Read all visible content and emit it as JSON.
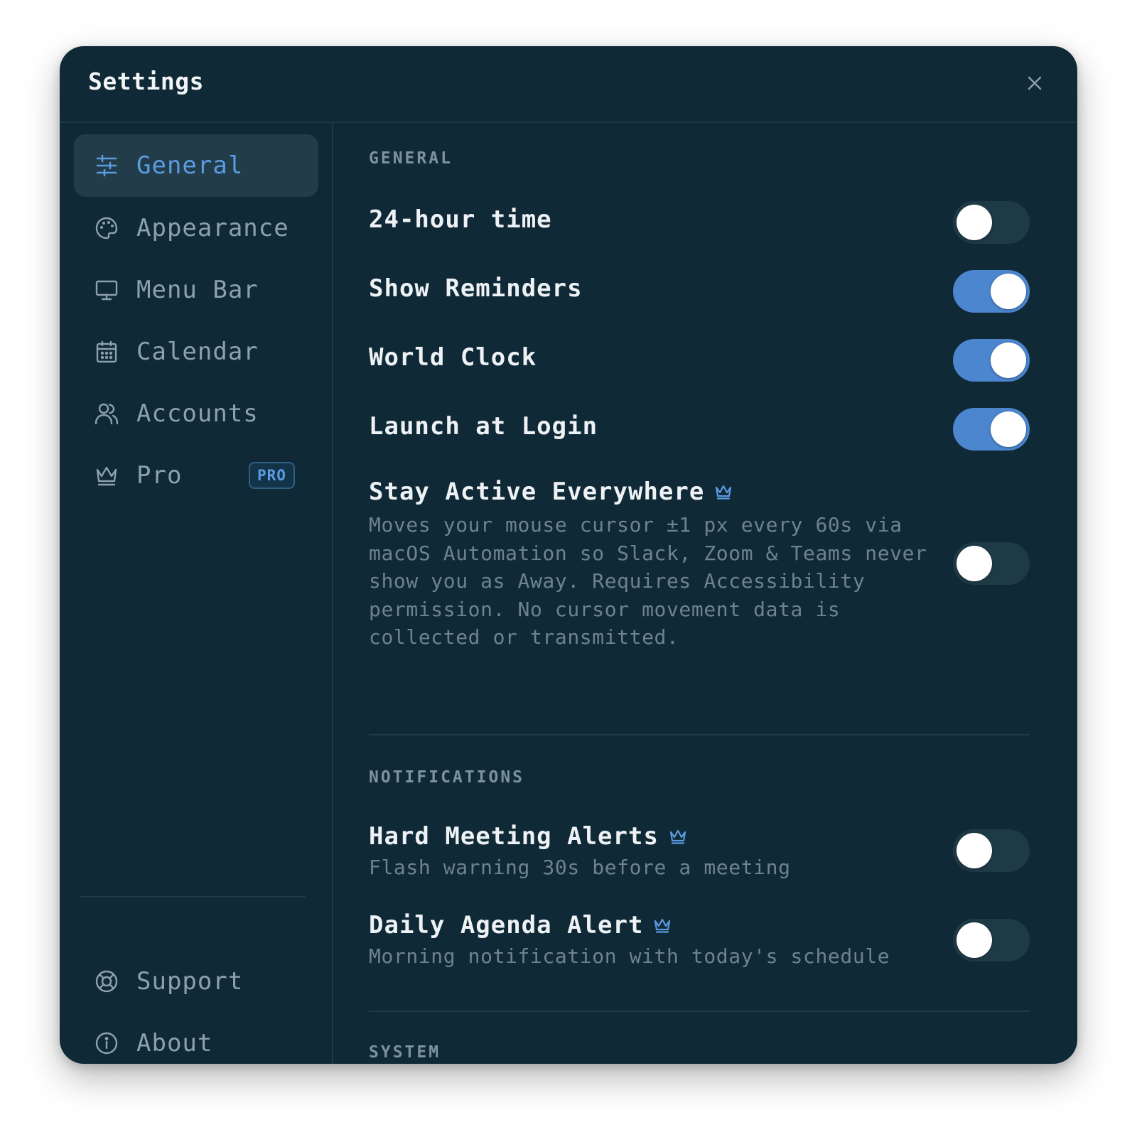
{
  "window": {
    "title": "Settings"
  },
  "sidebar": {
    "items": [
      {
        "label": "General",
        "icon": "sliders-icon",
        "active": true
      },
      {
        "label": "Appearance",
        "icon": "palette-icon",
        "active": false
      },
      {
        "label": "Menu Bar",
        "icon": "monitor-icon",
        "active": false
      },
      {
        "label": "Calendar",
        "icon": "calendar-icon",
        "active": false
      },
      {
        "label": "Accounts",
        "icon": "users-icon",
        "active": false
      },
      {
        "label": "Pro",
        "icon": "crown-icon",
        "active": false,
        "badge": "PRO"
      }
    ],
    "footer_items": [
      {
        "label": "Support",
        "icon": "lifebuoy-icon"
      },
      {
        "label": "About",
        "icon": "info-icon"
      }
    ]
  },
  "content": {
    "general": {
      "heading": "GENERAL",
      "settings": [
        {
          "label": "24-hour time",
          "enabled": false
        },
        {
          "label": "Show Reminders",
          "enabled": true
        },
        {
          "label": "World Clock",
          "enabled": true
        },
        {
          "label": "Launch at Login",
          "enabled": true
        },
        {
          "label": "Stay Active Everywhere",
          "pro": true,
          "description": "Moves your mouse cursor ±1 px every 60s via macOS Automation so Slack, Zoom & Teams never show you as Away. Requires Accessibility permission. No cursor movement data is collected or transmitted.",
          "enabled": false
        }
      ]
    },
    "notifications": {
      "heading": "NOTIFICATIONS",
      "settings": [
        {
          "label": "Hard Meeting Alerts",
          "pro": true,
          "description": "Flash warning 30s before a meeting",
          "enabled": false
        },
        {
          "label": "Daily Agenda Alert",
          "pro": true,
          "description": "Morning notification with today's schedule",
          "enabled": false
        }
      ]
    },
    "system": {
      "heading": "SYSTEM"
    }
  },
  "colors": {
    "window_bg": "#0f2936",
    "accent": "#4b86cf",
    "active_nav_bg": "#223c4a",
    "toggle_off": "#1f3a47"
  }
}
